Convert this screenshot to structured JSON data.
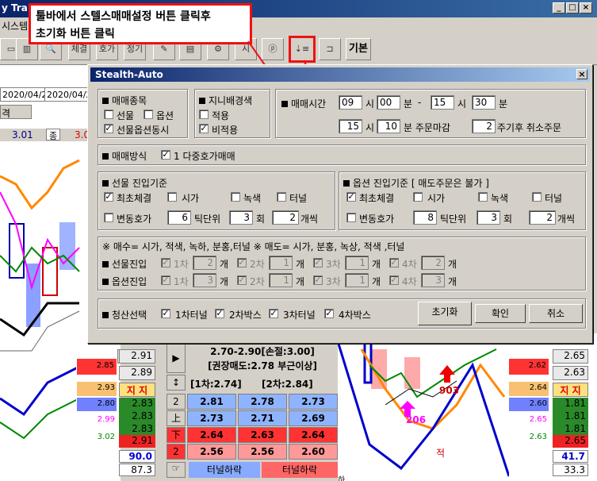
{
  "window": {
    "title": "y Tra",
    "menu_fragment": "시스템"
  },
  "callout": {
    "line1": "툴바에서 스텔스매매설정 버튼 클릭후",
    "line2": "초기화 버튼 클릭"
  },
  "toolbar": {
    "btn_chejul": "체결",
    "btn_hoga": "호가",
    "btn_jeonggi": "정기",
    "btn_gibon": "기본",
    "btn_si": "시"
  },
  "left_panel": {
    "date1": "2020/04/22",
    "date2": "2020/04/2",
    "label_gyeok": "격",
    "val_301": "3.01",
    "label_jong": "종",
    "val_30": "3.0"
  },
  "dialog": {
    "title": "Stealth-Auto",
    "g1": {
      "title": "매매종목",
      "opt1": "선물",
      "opt2": "옵션",
      "opt3": "선물옵션동시"
    },
    "g2": {
      "title": "지니배경색",
      "opt1": "적용",
      "opt2": "비적용"
    },
    "g3": {
      "title": "매매시간",
      "h1": "09",
      "l_si": "시",
      "m1": "00",
      "l_bun": "분",
      "dash": "-",
      "h2": "15",
      "m2": "30",
      "s_h": "15",
      "s_m": "10",
      "l_mm": "분 주문마감",
      "cyc": "2",
      "l_cyc": "주기후 취소주문"
    },
    "g4": {
      "title": "매매방식",
      "opt": "1 다중호가매매"
    },
    "g5": {
      "title": "선물 진입기준",
      "opt1": "최초체결",
      "opt2": "시가",
      "opt3": "녹색",
      "opt4": "터널",
      "opt5": "변동호가",
      "tick": "6",
      "l_tick": "틱단위",
      "cnt": "3",
      "l_cnt": "회",
      "num": "2",
      "l_num": "개씩"
    },
    "g6": {
      "title": "옵션 진입기준 [ 매도주문은 불가 ]",
      "opt1": "최초체결",
      "opt2": "시가",
      "opt3": "녹색",
      "opt4": "터널",
      "opt5": "변동호가",
      "tick": "8",
      "l_tick": "틱단위",
      "cnt": "3",
      "l_cnt": "회",
      "num": "2",
      "l_num": "개씩"
    },
    "g7": {
      "note": "※ 매수= 시가, 적색, 녹하, 분홍,터널  ※ 매도= 시가, 분홍, 녹상, 적색 ,터널",
      "row1": "선물진입",
      "row2": "옵션진입",
      "c1": "1차",
      "c2": "2차",
      "c3": "3차",
      "c4": "4차",
      "unit": "개",
      "f1": "2",
      "f2": "1",
      "f3": "1",
      "f4": "2",
      "o1": "3",
      "o2": "1",
      "o3": "1",
      "o4": "3"
    },
    "g8": {
      "title": "청산선택",
      "opt1": "1차터널",
      "opt2": "2차박스",
      "opt3": "3차터널",
      "opt4": "4차박스"
    },
    "reset_label": "초기화",
    "ok_label": "확인",
    "cancel_label": "취소"
  },
  "mid_panel": {
    "r1": "2.70-2.90[손절:3.00]",
    "r2": "[권장매도:2.78 부근이상]",
    "r3a": "[1차:2.74]",
    "r3b": "[2차:2.84]",
    "rows": [
      [
        "2",
        "2.81",
        "2.78",
        "2.73"
      ],
      [
        "上",
        "2.73",
        "2.71",
        "2.69"
      ],
      [
        "下",
        "2.64",
        "2.63",
        "2.64"
      ],
      [
        "2",
        "2.56",
        "2.56",
        "2.60"
      ]
    ],
    "tunnel1": "터널하락",
    "tunnel2": "터널하락",
    "icon_play": "▶",
    "icon_updown": "↕"
  },
  "left_col": {
    "v1": "2.91",
    "v2": "2.89",
    "v3": "2.85",
    "v4": "2.93",
    "v5": "지 지",
    "v6": "2.80",
    "v7": "2.83",
    "v8": "2.99",
    "v9": "2.83",
    "v10": "3.02",
    "v11": "2.83",
    "v12": "2.91",
    "v13": "90.0",
    "v14": "87.3"
  },
  "right_col": {
    "v1": "2.65",
    "v2": "2.63",
    "v3": "2.62",
    "v4": "2.64",
    "v5": "지 지",
    "v6": "2.60",
    "v7": "1.81",
    "v8": "2.65",
    "v9": "1.81",
    "v10": "2.63",
    "v11": "1.81",
    "v12": "2.65",
    "v13": "41.7",
    "v14": "33.3"
  },
  "chart_labels": {
    "a": "206",
    "b": "903",
    "c": "적",
    "d": "하"
  }
}
